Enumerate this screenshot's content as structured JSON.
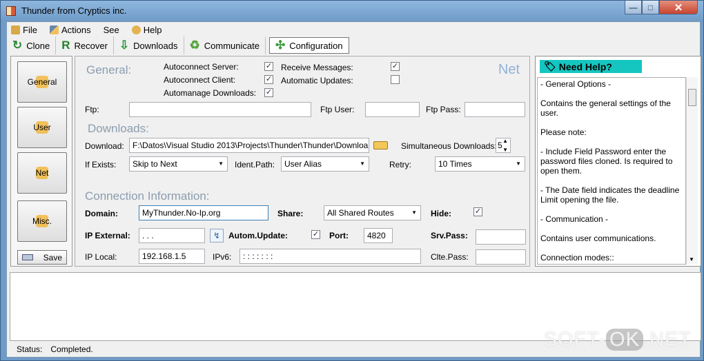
{
  "window": {
    "title": "Thunder from Cryptics inc.",
    "controls": {
      "minimize": "—",
      "maximize": "□",
      "close": "✕"
    }
  },
  "menu": [
    "File",
    "Actions",
    "See",
    "Help"
  ],
  "toolbar": [
    "Clone",
    "Recover",
    "Downloads",
    "Communicate",
    "Configuration"
  ],
  "sidebar": {
    "general": "General",
    "user": "User",
    "net": "Net",
    "misc": "Misc.",
    "save": "Save"
  },
  "general": {
    "title": "General:",
    "autoconnect_server": "Autoconnect Server:",
    "autoconnect_client": "Autoconnect Client:",
    "automanage_downloads": "Automanage Downloads:",
    "receive_messages": "Receive Messages:",
    "automatic_updates": "Automatic Updates:",
    "checked_server": "✓",
    "checked_client": "✓",
    "checked_manage": "✓",
    "checked_receive": "✓"
  },
  "net": {
    "title": "Net"
  },
  "ftp": {
    "ftp": "Ftp:",
    "user": "Ftp User:",
    "pass": "Ftp Pass:"
  },
  "downloads": {
    "title": "Downloads:",
    "download": "Download:",
    "path": "F:\\Datos\\Visual Studio 2013\\Projects\\Thunder\\Thunder\\Downloa",
    "simultaneous": "Simultaneous Downloads:",
    "simultaneous_value": "5",
    "if_exists": "If Exists:",
    "if_exists_value": "Skip to Next",
    "ident_path": "Ident.Path:",
    "ident_path_value": "User Alias",
    "retry": "Retry:",
    "retry_value": "10 Times"
  },
  "connection": {
    "title": "Connection Information:",
    "domain": "Domain:",
    "domain_value": "MyThunder.No-Ip.org",
    "share": "Share:",
    "share_value": "All Shared Routes",
    "hide": "Hide:",
    "ip_external": "IP External:",
    "ip_external_value": " .   .   .",
    "autom_update": "Autom.Update:",
    "port": "Port:",
    "port_value": "4820",
    "srv_pass": "Srv.Pass:",
    "ip_local": "IP Local:",
    "ip_local_value": "192.168.1.5",
    "ipv6": "IPv6:",
    "ipv6_value": ":    :    :    :    :    :    :",
    "clte_pass": "Clte.Pass:",
    "hide_check": "✓",
    "update_check": "✓"
  },
  "help": {
    "title": "Need Help?",
    "text": "- General Options -\n\nContains the general settings of the user.\n\nPlease note:\n\n- Include Field Password enter the password files cloned. Is required to open them.\n\n- The Date field indicates the deadline Limit opening the file.\n\n- Communication -\n\nContains user communications.\n\nConnection modes::"
  },
  "status": {
    "label": "Status:",
    "value": "Completed."
  },
  "watermark": {
    "left": "SOFT-",
    "badge": "OK",
    "right": ".NET"
  },
  "colors": {
    "help_header": "#15C6C0",
    "window_blue": "#6F9BC8",
    "section_gray": "#8B9DAF"
  }
}
